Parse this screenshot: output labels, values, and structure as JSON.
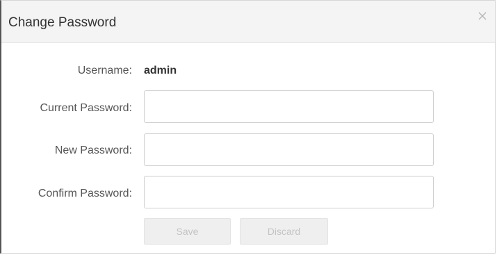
{
  "dialog": {
    "title": "Change Password",
    "close_icon": "close-icon"
  },
  "form": {
    "username_label": "Username:",
    "username_value": "admin",
    "current_password_label": "Current Password:",
    "current_password_value": "",
    "new_password_label": "New Password:",
    "new_password_value": "",
    "confirm_password_label": "Confirm Password:",
    "confirm_password_value": ""
  },
  "buttons": {
    "save_label": "Save",
    "discard_label": "Discard",
    "disabled_text_color": "#c4c4c4"
  }
}
